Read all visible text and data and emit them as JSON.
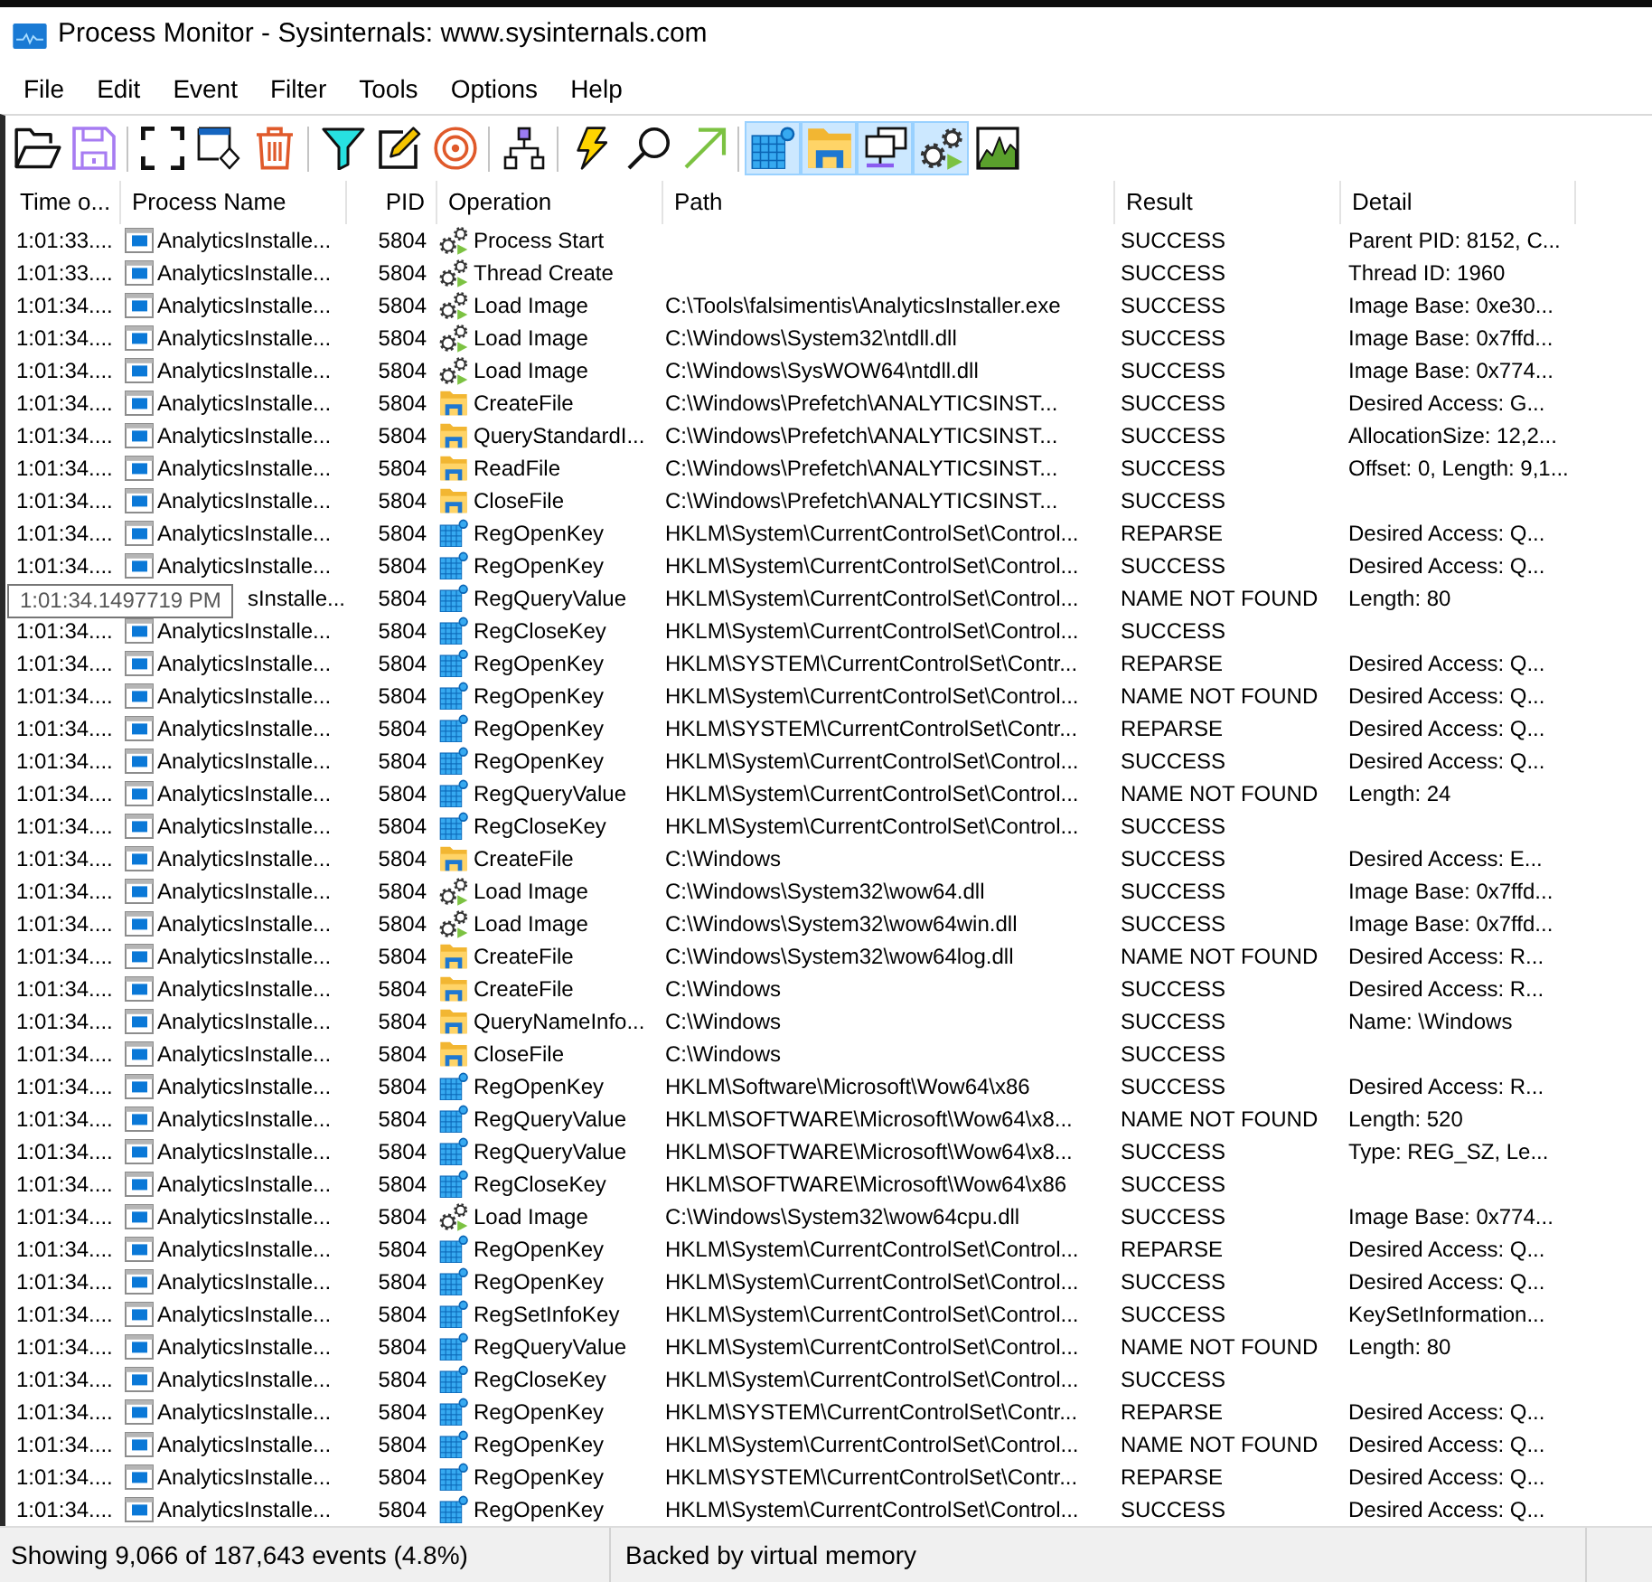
{
  "window": {
    "title": "Process Monitor - Sysinternals: www.sysinternals.com"
  },
  "menu": [
    "File",
    "Edit",
    "Event",
    "Filter",
    "Tools",
    "Options",
    "Help"
  ],
  "toolbar": {
    "toggles": [
      {
        "kind": "registry",
        "selected": true
      },
      {
        "kind": "file",
        "selected": true
      },
      {
        "kind": "network",
        "selected": true
      },
      {
        "kind": "process",
        "selected": true
      },
      {
        "kind": "profiling",
        "selected": false
      }
    ]
  },
  "table": {
    "columns": [
      "Time o...",
      "Process Name",
      "PID",
      "Operation",
      "Path",
      "Result",
      "Detail"
    ],
    "rows": [
      {
        "time": "1:01:33....",
        "process": "AnalyticsInstalle...",
        "pid": "5804",
        "kind": "process",
        "operation": "Process Start",
        "result": "SUCCESS",
        "detail": "Parent PID: 8152, C..."
      },
      {
        "time": "1:01:33....",
        "process": "AnalyticsInstalle...",
        "pid": "5804",
        "kind": "process",
        "operation": "Thread Create",
        "result": "SUCCESS",
        "detail": "Thread ID: 1960"
      },
      {
        "time": "1:01:34....",
        "process": "AnalyticsInstalle...",
        "pid": "5804",
        "kind": "process",
        "operation": "Load Image",
        "path": "C:\\Tools\\falsimentis\\AnalyticsInstaller.exe",
        "result": "SUCCESS",
        "detail": "Image Base: 0xe30..."
      },
      {
        "time": "1:01:34....",
        "process": "AnalyticsInstalle...",
        "pid": "5804",
        "kind": "process",
        "operation": "Load Image",
        "path": "C:\\Windows\\System32\\ntdll.dll",
        "result": "SUCCESS",
        "detail": "Image Base: 0x7ffd..."
      },
      {
        "time": "1:01:34....",
        "process": "AnalyticsInstalle...",
        "pid": "5804",
        "kind": "process",
        "operation": "Load Image",
        "path": "C:\\Windows\\SysWOW64\\ntdll.dll",
        "result": "SUCCESS",
        "detail": "Image Base: 0x774..."
      },
      {
        "time": "1:01:34....",
        "process": "AnalyticsInstalle...",
        "pid": "5804",
        "kind": "file",
        "operation": "CreateFile",
        "path": "C:\\Windows\\Prefetch\\ANALYTICSINST...",
        "result": "SUCCESS",
        "detail": "Desired Access: G..."
      },
      {
        "time": "1:01:34....",
        "process": "AnalyticsInstalle...",
        "pid": "5804",
        "kind": "file",
        "operation": "QueryStandardI...",
        "path": "C:\\Windows\\Prefetch\\ANALYTICSINST...",
        "result": "SUCCESS",
        "detail": "AllocationSize: 12,2..."
      },
      {
        "time": "1:01:34....",
        "process": "AnalyticsInstalle...",
        "pid": "5804",
        "kind": "file",
        "operation": "ReadFile",
        "path": "C:\\Windows\\Prefetch\\ANALYTICSINST...",
        "result": "SUCCESS",
        "detail": "Offset: 0, Length: 9,1..."
      },
      {
        "time": "1:01:34....",
        "process": "AnalyticsInstalle...",
        "pid": "5804",
        "kind": "file",
        "operation": "CloseFile",
        "path": "C:\\Windows\\Prefetch\\ANALYTICSINST...",
        "result": "SUCCESS"
      },
      {
        "time": "1:01:34....",
        "process": "AnalyticsInstalle...",
        "pid": "5804",
        "kind": "registry",
        "operation": "RegOpenKey",
        "path": "HKLM\\System\\CurrentControlSet\\Control...",
        "result": "REPARSE",
        "detail": "Desired Access: Q..."
      },
      {
        "time": "1:01:34....",
        "process": "AnalyticsInstalle...",
        "pid": "5804",
        "kind": "registry",
        "operation": "RegOpenKey",
        "path": "HKLM\\System\\CurrentControlSet\\Control...",
        "result": "SUCCESS",
        "detail": "Desired Access: Q..."
      },
      {
        "tooltip": "1:01:34.1497719 PM",
        "process": "sInstalle...",
        "pid": "5804",
        "kind": "registry",
        "operation": "RegQueryValue",
        "path": "HKLM\\System\\CurrentControlSet\\Control...",
        "result": "NAME NOT FOUND",
        "detail": "Length: 80"
      },
      {
        "time": "1:01:34....",
        "process": "AnalyticsInstalle...",
        "pid": "5804",
        "kind": "registry",
        "operation": "RegCloseKey",
        "path": "HKLM\\System\\CurrentControlSet\\Control...",
        "result": "SUCCESS"
      },
      {
        "time": "1:01:34....",
        "process": "AnalyticsInstalle...",
        "pid": "5804",
        "kind": "registry",
        "operation": "RegOpenKey",
        "path": "HKLM\\SYSTEM\\CurrentControlSet\\Contr...",
        "result": "REPARSE",
        "detail": "Desired Access: Q..."
      },
      {
        "time": "1:01:34....",
        "process": "AnalyticsInstalle...",
        "pid": "5804",
        "kind": "registry",
        "operation": "RegOpenKey",
        "path": "HKLM\\System\\CurrentControlSet\\Control...",
        "result": "NAME NOT FOUND",
        "detail": "Desired Access: Q..."
      },
      {
        "time": "1:01:34....",
        "process": "AnalyticsInstalle...",
        "pid": "5804",
        "kind": "registry",
        "operation": "RegOpenKey",
        "path": "HKLM\\SYSTEM\\CurrentControlSet\\Contr...",
        "result": "REPARSE",
        "detail": "Desired Access: Q..."
      },
      {
        "time": "1:01:34....",
        "process": "AnalyticsInstalle...",
        "pid": "5804",
        "kind": "registry",
        "operation": "RegOpenKey",
        "path": "HKLM\\System\\CurrentControlSet\\Control...",
        "result": "SUCCESS",
        "detail": "Desired Access: Q..."
      },
      {
        "time": "1:01:34....",
        "process": "AnalyticsInstalle...",
        "pid": "5804",
        "kind": "registry",
        "operation": "RegQueryValue",
        "path": "HKLM\\System\\CurrentControlSet\\Control...",
        "result": "NAME NOT FOUND",
        "detail": "Length: 24"
      },
      {
        "time": "1:01:34....",
        "process": "AnalyticsInstalle...",
        "pid": "5804",
        "kind": "registry",
        "operation": "RegCloseKey",
        "path": "HKLM\\System\\CurrentControlSet\\Control...",
        "result": "SUCCESS"
      },
      {
        "time": "1:01:34....",
        "process": "AnalyticsInstalle...",
        "pid": "5804",
        "kind": "file",
        "operation": "CreateFile",
        "path": "C:\\Windows",
        "result": "SUCCESS",
        "detail": "Desired Access: E..."
      },
      {
        "time": "1:01:34....",
        "process": "AnalyticsInstalle...",
        "pid": "5804",
        "kind": "process",
        "operation": "Load Image",
        "path": "C:\\Windows\\System32\\wow64.dll",
        "result": "SUCCESS",
        "detail": "Image Base: 0x7ffd..."
      },
      {
        "time": "1:01:34....",
        "process": "AnalyticsInstalle...",
        "pid": "5804",
        "kind": "process",
        "operation": "Load Image",
        "path": "C:\\Windows\\System32\\wow64win.dll",
        "result": "SUCCESS",
        "detail": "Image Base: 0x7ffd..."
      },
      {
        "time": "1:01:34....",
        "process": "AnalyticsInstalle...",
        "pid": "5804",
        "kind": "file",
        "operation": "CreateFile",
        "path": "C:\\Windows\\System32\\wow64log.dll",
        "result": "NAME NOT FOUND",
        "detail": "Desired Access: R..."
      },
      {
        "time": "1:01:34....",
        "process": "AnalyticsInstalle...",
        "pid": "5804",
        "kind": "file",
        "operation": "CreateFile",
        "path": "C:\\Windows",
        "result": "SUCCESS",
        "detail": "Desired Access: R..."
      },
      {
        "time": "1:01:34....",
        "process": "AnalyticsInstalle...",
        "pid": "5804",
        "kind": "file",
        "operation": "QueryNameInfo...",
        "path": "C:\\Windows",
        "result": "SUCCESS",
        "detail": "Name: \\Windows"
      },
      {
        "time": "1:01:34....",
        "process": "AnalyticsInstalle...",
        "pid": "5804",
        "kind": "file",
        "operation": "CloseFile",
        "path": "C:\\Windows",
        "result": "SUCCESS"
      },
      {
        "time": "1:01:34....",
        "process": "AnalyticsInstalle...",
        "pid": "5804",
        "kind": "registry",
        "operation": "RegOpenKey",
        "path": "HKLM\\Software\\Microsoft\\Wow64\\x86",
        "result": "SUCCESS",
        "detail": "Desired Access: R..."
      },
      {
        "time": "1:01:34....",
        "process": "AnalyticsInstalle...",
        "pid": "5804",
        "kind": "registry",
        "operation": "RegQueryValue",
        "path": "HKLM\\SOFTWARE\\Microsoft\\Wow64\\x8...",
        "result": "NAME NOT FOUND",
        "detail": "Length: 520"
      },
      {
        "time": "1:01:34....",
        "process": "AnalyticsInstalle...",
        "pid": "5804",
        "kind": "registry",
        "operation": "RegQueryValue",
        "path": "HKLM\\SOFTWARE\\Microsoft\\Wow64\\x8...",
        "result": "SUCCESS",
        "detail": "Type: REG_SZ, Le..."
      },
      {
        "time": "1:01:34....",
        "process": "AnalyticsInstalle...",
        "pid": "5804",
        "kind": "registry",
        "operation": "RegCloseKey",
        "path": "HKLM\\SOFTWARE\\Microsoft\\Wow64\\x86",
        "result": "SUCCESS"
      },
      {
        "time": "1:01:34....",
        "process": "AnalyticsInstalle...",
        "pid": "5804",
        "kind": "process",
        "operation": "Load Image",
        "path": "C:\\Windows\\System32\\wow64cpu.dll",
        "result": "SUCCESS",
        "detail": "Image Base: 0x774..."
      },
      {
        "time": "1:01:34....",
        "process": "AnalyticsInstalle...",
        "pid": "5804",
        "kind": "registry",
        "operation": "RegOpenKey",
        "path": "HKLM\\System\\CurrentControlSet\\Control...",
        "result": "REPARSE",
        "detail": "Desired Access: Q..."
      },
      {
        "time": "1:01:34....",
        "process": "AnalyticsInstalle...",
        "pid": "5804",
        "kind": "registry",
        "operation": "RegOpenKey",
        "path": "HKLM\\System\\CurrentControlSet\\Control...",
        "result": "SUCCESS",
        "detail": "Desired Access: Q..."
      },
      {
        "time": "1:01:34....",
        "process": "AnalyticsInstalle...",
        "pid": "5804",
        "kind": "registry",
        "operation": "RegSetInfoKey",
        "path": "HKLM\\System\\CurrentControlSet\\Control...",
        "result": "SUCCESS",
        "detail": "KeySetInformation..."
      },
      {
        "time": "1:01:34....",
        "process": "AnalyticsInstalle...",
        "pid": "5804",
        "kind": "registry",
        "operation": "RegQueryValue",
        "path": "HKLM\\System\\CurrentControlSet\\Control...",
        "result": "NAME NOT FOUND",
        "detail": "Length: 80"
      },
      {
        "time": "1:01:34....",
        "process": "AnalyticsInstalle...",
        "pid": "5804",
        "kind": "registry",
        "operation": "RegCloseKey",
        "path": "HKLM\\System\\CurrentControlSet\\Control...",
        "result": "SUCCESS"
      },
      {
        "time": "1:01:34....",
        "process": "AnalyticsInstalle...",
        "pid": "5804",
        "kind": "registry",
        "operation": "RegOpenKey",
        "path": "HKLM\\SYSTEM\\CurrentControlSet\\Contr...",
        "result": "REPARSE",
        "detail": "Desired Access: Q..."
      },
      {
        "time": "1:01:34....",
        "process": "AnalyticsInstalle...",
        "pid": "5804",
        "kind": "registry",
        "operation": "RegOpenKey",
        "path": "HKLM\\System\\CurrentControlSet\\Control...",
        "result": "NAME NOT FOUND",
        "detail": "Desired Access: Q..."
      },
      {
        "time": "1:01:34....",
        "process": "AnalyticsInstalle...",
        "pid": "5804",
        "kind": "registry",
        "operation": "RegOpenKey",
        "path": "HKLM\\SYSTEM\\CurrentControlSet\\Contr...",
        "result": "REPARSE",
        "detail": "Desired Access: Q..."
      },
      {
        "time": "1:01:34....",
        "process": "AnalyticsInstalle...",
        "pid": "5804",
        "kind": "registry",
        "operation": "RegOpenKey",
        "path": "HKLM\\System\\CurrentControlSet\\Control...",
        "result": "SUCCESS",
        "detail": "Desired Access: Q..."
      }
    ]
  },
  "status_bar": {
    "events": "Showing 9,066 of 187,643 events (4.8%)",
    "backing": "Backed by virtual memory"
  }
}
